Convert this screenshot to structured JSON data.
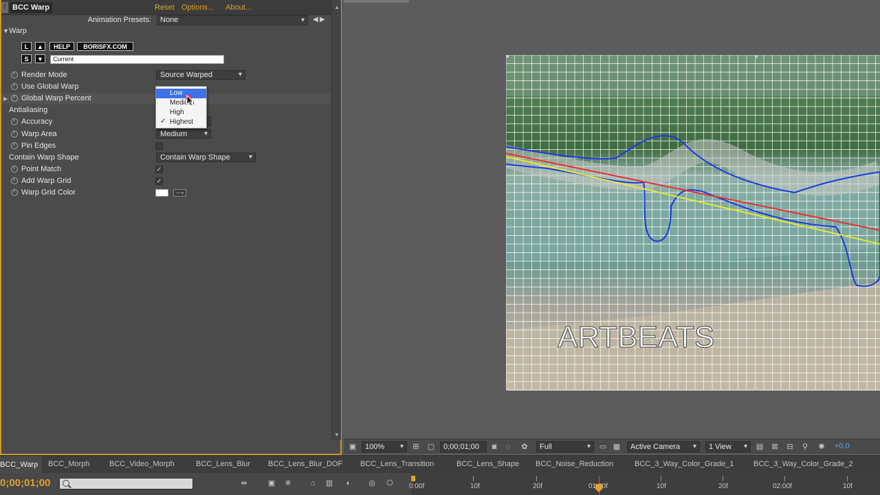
{
  "effect_panel": {
    "effect_name": "BCC Warp",
    "header_links": [
      "Reset",
      "Options...",
      "About..."
    ],
    "animation_presets": {
      "label": "Animation Presets:",
      "value": "None"
    },
    "group_label": "Warp",
    "mini_buttons": {
      "load": "L",
      "up": "▲",
      "help": "HELP",
      "site": "BORISFX.COM",
      "save": "S",
      "down": "▼"
    },
    "preset_name": "Current",
    "properties": {
      "render_mode": {
        "label": "Render Mode",
        "value": "Source Warped"
      },
      "use_global_warp": {
        "label": "Use Global Warp"
      },
      "global_warp_percent": {
        "label": "Global Warp Percent"
      },
      "antialiasing": {
        "label": "Antialiasing"
      },
      "accuracy": {
        "label": "Accuracy"
      },
      "warp_area": {
        "label": "Warp Area",
        "value": "Medium"
      },
      "pin_edges": {
        "label": "Pin Edges",
        "checked": false
      },
      "contain_warp_shape": {
        "label": "Contain Warp Shape",
        "value": "Contain Warp Shape"
      },
      "point_match": {
        "label": "Point Match",
        "checked": true
      },
      "add_warp_grid": {
        "label": "Add Warp Grid",
        "checked": true
      },
      "warp_grid_color": {
        "label": "Warp Grid Color",
        "color": "#ffffff"
      }
    },
    "dropdown_menu": {
      "options": [
        "Low",
        "Medium",
        "High",
        "Highest"
      ],
      "highlighted": "Low",
      "checked": "Highest",
      "check_mark": "✓"
    },
    "colors": {
      "accent_border": "#c89a2e",
      "link": "#e3a227"
    }
  },
  "viewer": {
    "watermark": "ARTBEATS",
    "toolbar": {
      "magnification": "100%",
      "timecode": "0;00;01;00",
      "resolution": "Full",
      "camera": "Active Camera",
      "views": "1 View",
      "exposure": "+0.0"
    }
  },
  "timeline": {
    "tabs": [
      "BCC_Warp",
      "BCC_Morph",
      "BCC_Video_Morph",
      "BCC_Lens_Blur",
      "BCC_Lens_Blur_DOF",
      "BCC_Lens_Transition",
      "BCC_Lens_Shape",
      "BCC_Noise_Reduction",
      "BCC_3_Way_Color_Grade_1",
      "BCC_3_Way_Color_Grade_2"
    ],
    "close_glyph": "×",
    "current_time": "0;00;01;00",
    "ruler_labels": [
      "0:00f",
      "10f",
      "20f",
      "01:00f",
      "10f",
      "20f",
      "02:00f",
      "10f"
    ]
  }
}
